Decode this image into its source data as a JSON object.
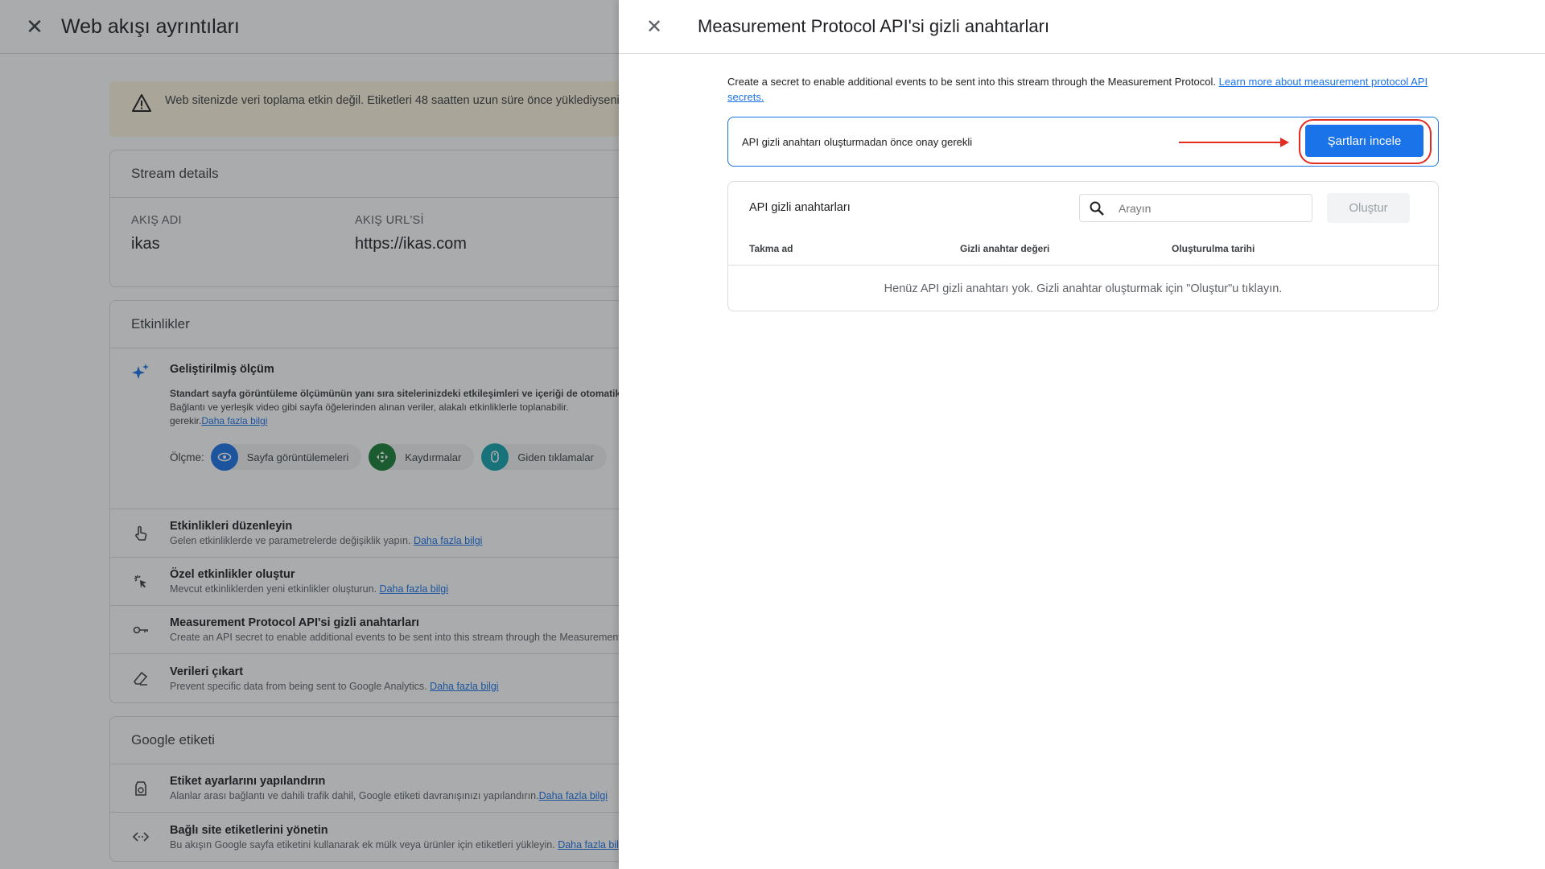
{
  "background": {
    "title": "Web akışı ayrıntıları",
    "warning": "Web sitenizde veri toplama etkin değil. Etiketleri 48 saatten uzun süre önce yüklediyseniz olun.",
    "stream_details": {
      "heading": "Stream details",
      "name_label": "AKIŞ ADI",
      "name_value": "ikas",
      "url_label": "AKIŞ URL'Sİ",
      "url_value": "https://ikas.com"
    },
    "events": {
      "heading": "Etkinlikler",
      "enhanced_title": "Geliştirilmiş ölçüm",
      "enhanced_desc_bold": "Standart sayfa görüntüleme ölçümünün yanı sıra sitelerinizdeki etkileşimleri ve içeriği de otomatik",
      "enhanced_desc": "Bağlantı ve yerleşik video gibi sayfa öğelerinden alınan veriler, alakalı etkinliklerle toplanabilir.",
      "enhanced_desc_end": "gerekir.",
      "learn_more": "Daha fazla bilgi",
      "measures_label": "Ölçme:",
      "measures": [
        "Sayfa görüntülemeleri",
        "Kaydırmalar",
        "Giden tıklamalar"
      ],
      "rows": [
        {
          "title": "Etkinlikleri düzenleyin",
          "desc": "Gelen etkinliklerde ve parametrelerde değişiklik yapın.",
          "link": "Daha fazla bilgi"
        },
        {
          "title": "Özel etkinlikler oluştur",
          "desc": "Mevcut etkinliklerden yeni etkinlikler oluşturun.",
          "link": "Daha fazla bilgi"
        },
        {
          "title": "Measurement Protocol API'si gizli anahtarları",
          "desc": "Create an API secret to enable additional events to be sent into this stream through the Measurement Protocol.",
          "link": ""
        },
        {
          "title": "Verileri çıkart",
          "desc": "Prevent specific data from being sent to Google Analytics.",
          "link": "Daha fazla bilgi"
        }
      ]
    },
    "google_tag": {
      "heading": "Google etiketi",
      "rows": [
        {
          "title": "Etiket ayarlarını yapılandırın",
          "desc": "Alanlar arası bağlantı ve dahili trafik dahil, Google etiketi davranışınızı yapılandırın.",
          "link": "Daha fazla bilgi"
        },
        {
          "title": "Bağlı site etiketlerini yönetin",
          "desc": "Bu akışın Google sayfa etiketini kullanarak ek mülk veya ürünler için etiketleri yükleyin.",
          "link": "Daha fazla bilgi"
        }
      ]
    }
  },
  "panel": {
    "title": "Measurement Protocol API'si gizli anahtarları",
    "intro": "Create a secret to enable additional events to be sent into this stream through the Measurement Protocol. ",
    "intro_link": "Learn more about measurement protocol API secrets.",
    "consent_text": "API gizli anahtarı oluşturmadan önce onay gerekli",
    "review_button": "Şartları incele",
    "secrets_title": "API gizli anahtarları",
    "search_placeholder": "Arayın",
    "create_button": "Oluştur",
    "columns": [
      "Takma ad",
      "Gizli anahtar değeri",
      "Oluşturulma tarihi"
    ],
    "empty_message": "Henüz API gizli anahtarı yok. Gizli anahtar oluşturmak için \"Oluştur\"u tıklayın."
  },
  "colors": {
    "accent": "#1a73e8",
    "annotation": "#e52b1f",
    "overlay": "rgba(32,33,36,0.38)"
  }
}
